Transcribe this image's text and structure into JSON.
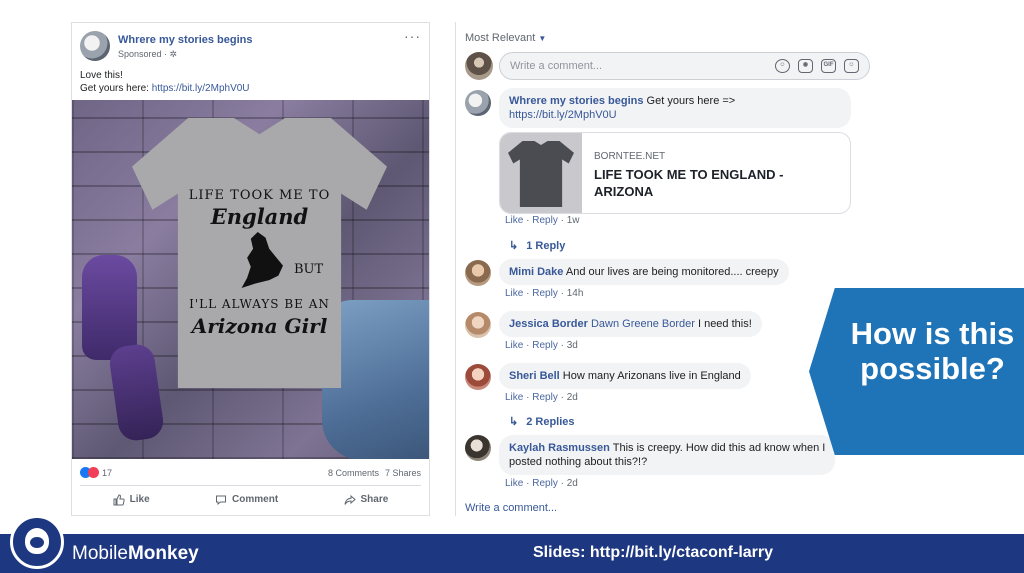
{
  "post": {
    "page_name": "Whrere my stories begins",
    "sponsored": "Sponsored · ✲",
    "text_line1": "Love this!",
    "text_prefix": "Get yours here: ",
    "text_link": "https://bit.ly/2MphV0U",
    "image": {
      "line1": "LIFE TOOK ME TO",
      "line2": "England",
      "but": "BUT",
      "line3": "I'LL ALWAYS BE AN",
      "line4": "Arizona Girl"
    },
    "reaction_count": "17",
    "comments_count": "8 Comments",
    "shares_count": "7 Shares",
    "actions": {
      "like": "Like",
      "comment": "Comment",
      "share": "Share"
    }
  },
  "comments_panel": {
    "sort_label": "Most Relevant",
    "composer_placeholder": "Write a comment...",
    "composer_icons": [
      "emoji-icon",
      "camera-icon",
      "gif-icon",
      "sticker-icon"
    ],
    "comments": [
      {
        "author": "Whrere my stories begins",
        "text": " Get yours here =>",
        "link": "https://bit.ly/2MphV0U",
        "like": "Like",
        "reply": "Reply",
        "time": "1w",
        "link_card": {
          "domain": "BORNTEE.NET",
          "title": "LIFE TOOK ME TO ENGLAND - ARIZONA"
        },
        "replies_label": "1 Reply"
      },
      {
        "author": "Mimi Dake",
        "text": " And our lives are being monitored.... creepy",
        "like": "Like",
        "reply": "Reply",
        "time": "14h"
      },
      {
        "author": "Jessica Border",
        "mention": "Dawn Greene Border",
        "text": " I need this!",
        "like": "Like",
        "reply": "Reply",
        "time": "3d"
      },
      {
        "author": "Sheri Bell",
        "text": " How many Arizonans live in England",
        "like": "Like",
        "reply": "Reply",
        "time": "2d",
        "replies_label": "2 Replies"
      },
      {
        "author": "Kaylah Rasmussen",
        "text_line1": " This is creepy. How did this ad know when I",
        "text_line2": "posted nothing about this?!?",
        "like": "Like",
        "reply": "Reply",
        "time": "2d"
      }
    ],
    "write_comment": "Write a comment..."
  },
  "callout": {
    "text": "How is this possible?"
  },
  "footer": {
    "brand_light": "Mobile",
    "brand_bold": "Monkey",
    "slides": "Slides: http://bit.ly/ctaconf-larry"
  },
  "colors": {
    "facebook_link": "#385898",
    "callout_blue": "#1f73b7",
    "footer_navy": "#1d3781"
  }
}
